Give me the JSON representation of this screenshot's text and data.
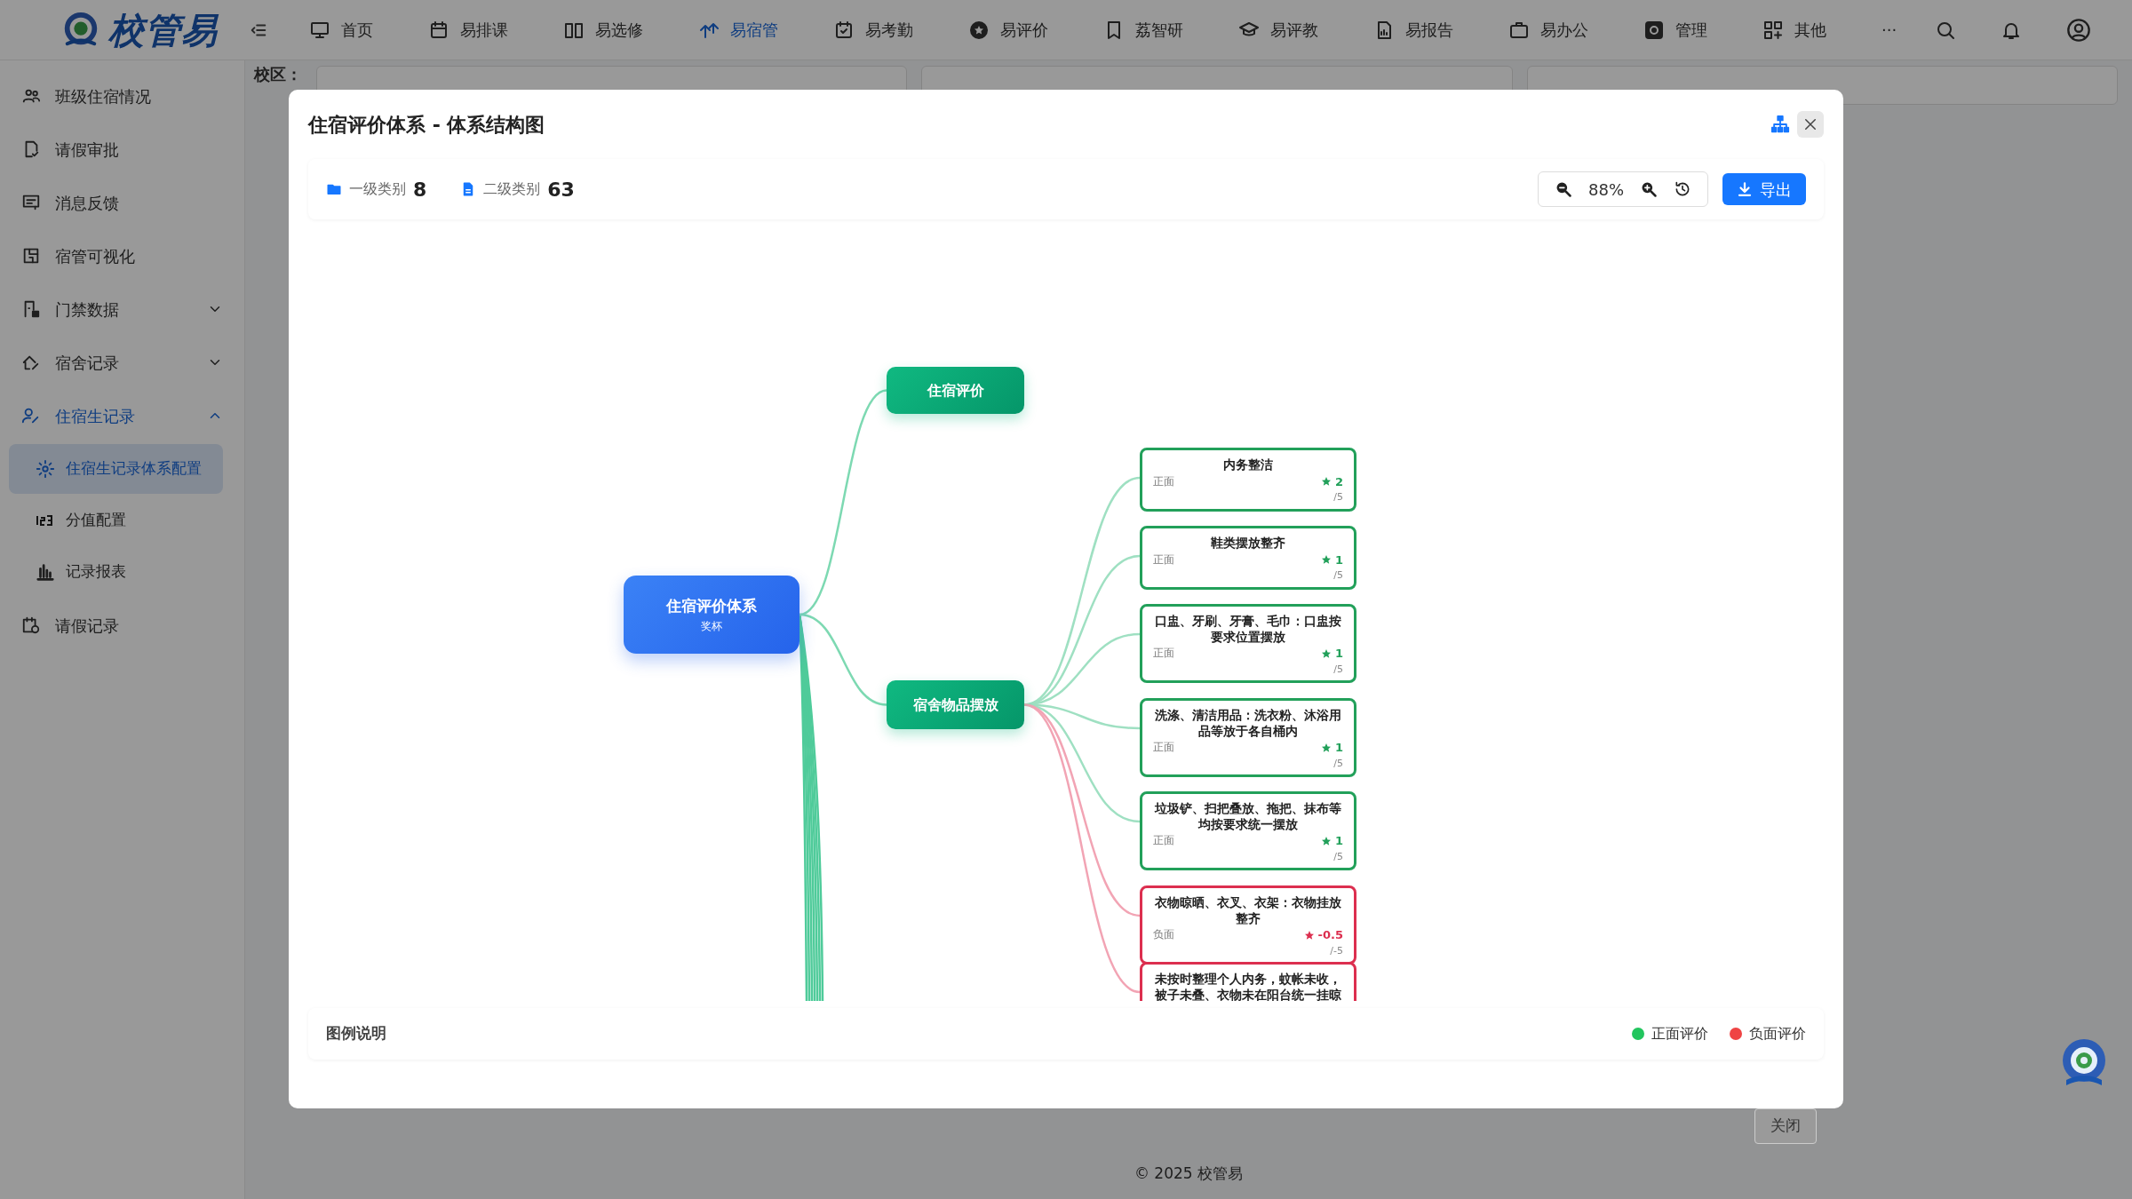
{
  "app": {
    "logo": "校管易"
  },
  "nav": [
    {
      "label": "首页",
      "selected": false
    },
    {
      "label": "易排课",
      "selected": false
    },
    {
      "label": "易选修",
      "selected": false
    },
    {
      "label": "易宿管",
      "selected": true
    },
    {
      "label": "易考勤",
      "selected": false
    },
    {
      "label": "易评价",
      "selected": false
    },
    {
      "label": "荔智研",
      "selected": false
    },
    {
      "label": "易评教",
      "selected": false
    },
    {
      "label": "易报告",
      "selected": false
    },
    {
      "label": "易办公",
      "selected": false
    },
    {
      "label": "管理",
      "selected": false
    },
    {
      "label": "其他",
      "selected": false
    }
  ],
  "nav_more": "···",
  "filters": [
    {
      "label": "校区："
    }
  ],
  "sidebar": [
    {
      "label": "班级住宿情况",
      "selected": false
    },
    {
      "label": "请假审批",
      "selected": false
    },
    {
      "label": "消息反馈",
      "selected": false
    },
    {
      "label": "宿管可视化",
      "selected": false
    },
    {
      "label": "门禁数据",
      "selected": false,
      "expanded": false
    },
    {
      "label": "宿舍记录",
      "selected": false,
      "expanded": false
    },
    {
      "label": "住宿生记录",
      "selected": true,
      "expanded": true,
      "children": [
        {
          "label": "住宿生记录体系配置",
          "selected": true
        },
        {
          "label": "分值配置",
          "selected": false
        },
        {
          "label": "记录报表",
          "selected": false
        }
      ]
    },
    {
      "label": "请假记录",
      "selected": false
    }
  ],
  "modal": {
    "title": "住宿评价体系 - 体系结构图",
    "stats": [
      {
        "label": "一级类别",
        "value": "8"
      },
      {
        "label": "二级类别",
        "value": "63"
      }
    ],
    "zoom": "88%",
    "export": "导出",
    "tree": {
      "title": "住宿评价体系",
      "subtitle": "奖杯",
      "children": [
        {
          "title": "住宿评价"
        },
        {
          "title": "宿舍物品摆放",
          "children": [
            {
              "title": "内务整洁",
              "kind": "positive",
              "type": "正面",
              "score": "2",
              "max": "/5"
            },
            {
              "title": "鞋类摆放整齐",
              "kind": "positive",
              "type": "正面",
              "score": "1",
              "max": "/5"
            },
            {
              "title": "口盅、牙刷、牙膏、毛巾：口盅按要求位置摆放",
              "kind": "positive",
              "type": "正面",
              "score": "1",
              "max": "/5"
            },
            {
              "title": "洗涤、清洁用品：洗衣粉、沐浴用品等放于各自桶内",
              "kind": "positive",
              "type": "正面",
              "score": "1",
              "max": "/5"
            },
            {
              "title": "垃圾铲、扫把叠放、拖把、抹布等均按要求统一摆放",
              "kind": "positive",
              "type": "正面",
              "score": "1",
              "max": "/5"
            },
            {
              "title": "衣物晾晒、衣叉、衣架：衣物挂放整齐",
              "kind": "negative",
              "type": "负面",
              "score": "-0.5",
              "max": "/-5"
            },
            {
              "title": "未按时整理个人内务，蚊帐未收，被子未叠、衣物未在阳台统一挂晾",
              "kind": "negative"
            }
          ]
        }
      ]
    },
    "legend": {
      "title": "图例说明",
      "items": [
        {
          "label": "正面评价",
          "color": "#22c55e"
        },
        {
          "label": "负面评价",
          "color": "#ef4444"
        }
      ]
    }
  },
  "close_button": "关闭",
  "footer": "© 2025 校管易"
}
